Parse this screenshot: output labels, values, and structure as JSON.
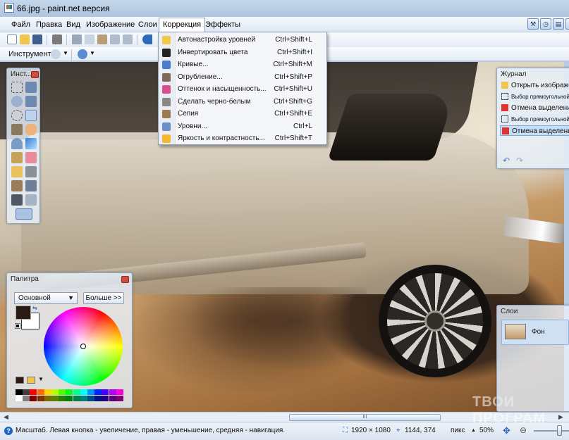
{
  "window": {
    "title": "66.jpg - paint.net версия"
  },
  "menubar": {
    "items": [
      {
        "id": "file",
        "label": "Файл"
      },
      {
        "id": "edit",
        "label": "Правка"
      },
      {
        "id": "view",
        "label": "Вид"
      },
      {
        "id": "image",
        "label": "Изображение"
      },
      {
        "id": "layers",
        "label": "Слои"
      },
      {
        "id": "adjustments",
        "label": "Коррекция"
      },
      {
        "id": "effects",
        "label": "Эффекты"
      }
    ]
  },
  "toolbar2": {
    "tool_label": "Инструмент:"
  },
  "dropdown": {
    "items": [
      {
        "label": "Автонастройка уровней",
        "shortcut": "Ctrl+Shift+L",
        "color": "#f2c94c"
      },
      {
        "label": "Инвертировать цвета",
        "shortcut": "Ctrl+Shift+I",
        "color": "#222222"
      },
      {
        "label": "Кривые...",
        "shortcut": "Ctrl+Shift+M",
        "color": "#4a7bd0"
      },
      {
        "label": "Огрубление...",
        "shortcut": "Ctrl+Shift+P",
        "color": "#7e6a5a"
      },
      {
        "label": "Оттенок и насыщенность...",
        "shortcut": "Ctrl+Shift+U",
        "color": "#d94e8f"
      },
      {
        "label": "Сделать черно-белым",
        "shortcut": "Ctrl+Shift+G",
        "color": "#888888"
      },
      {
        "label": "Сепия",
        "shortcut": "Ctrl+Shift+E",
        "color": "#9c7a52"
      },
      {
        "label": "Уровни...",
        "shortcut": "Ctrl+L",
        "color": "#6c8fc9"
      },
      {
        "label": "Яркость и контрастность...",
        "shortcut": "Ctrl+Shift+T",
        "color": "#f5b82e"
      }
    ]
  },
  "tools_panel": {
    "title": "Инст..."
  },
  "history_panel": {
    "title": "Журнал",
    "items": [
      {
        "label": "Открыть изображение",
        "size": "normal"
      },
      {
        "label": "Выбор прямоугольной области",
        "size": "small"
      },
      {
        "label": "Отмена выделения",
        "size": "normal"
      },
      {
        "label": "Выбор прямоугольной области",
        "size": "small"
      },
      {
        "label": "Отмена выделения",
        "size": "normal"
      }
    ]
  },
  "layers_panel": {
    "title": "Слои",
    "layer_name": "Фон"
  },
  "palette_panel": {
    "title": "Палитра",
    "mode": "Основной",
    "more_button": "Больше >>"
  },
  "palette_swatches": {
    "row1": [
      "#000000",
      "#404040",
      "#ff0000",
      "#ff6a00",
      "#ffd800",
      "#b6ff00",
      "#4cff00",
      "#00ff21",
      "#00ff90",
      "#00ffff",
      "#0094ff",
      "#0026ff",
      "#4800ff",
      "#b200ff",
      "#ff00dc"
    ],
    "row2": [
      "#ffffff",
      "#808080",
      "#7f0000",
      "#7f3300",
      "#7f6a00",
      "#5b7f00",
      "#267f00",
      "#007f0e",
      "#007f46",
      "#007f7f",
      "#004a7f",
      "#00137f",
      "#21007f",
      "#57007f",
      "#7f006e"
    ]
  },
  "statusbar": {
    "hint": "Масштаб. Левая кнопка - увеличение, правая - уменьшение, средняя - навигация.",
    "image_size": "1920 × 1080",
    "cursor_pos": "1144, 374",
    "units": "пикс",
    "zoom": "50%"
  },
  "watermark": "ТВОИ ПРОГРАМ",
  "scrollbar": {
    "thumb_grip": "III"
  }
}
